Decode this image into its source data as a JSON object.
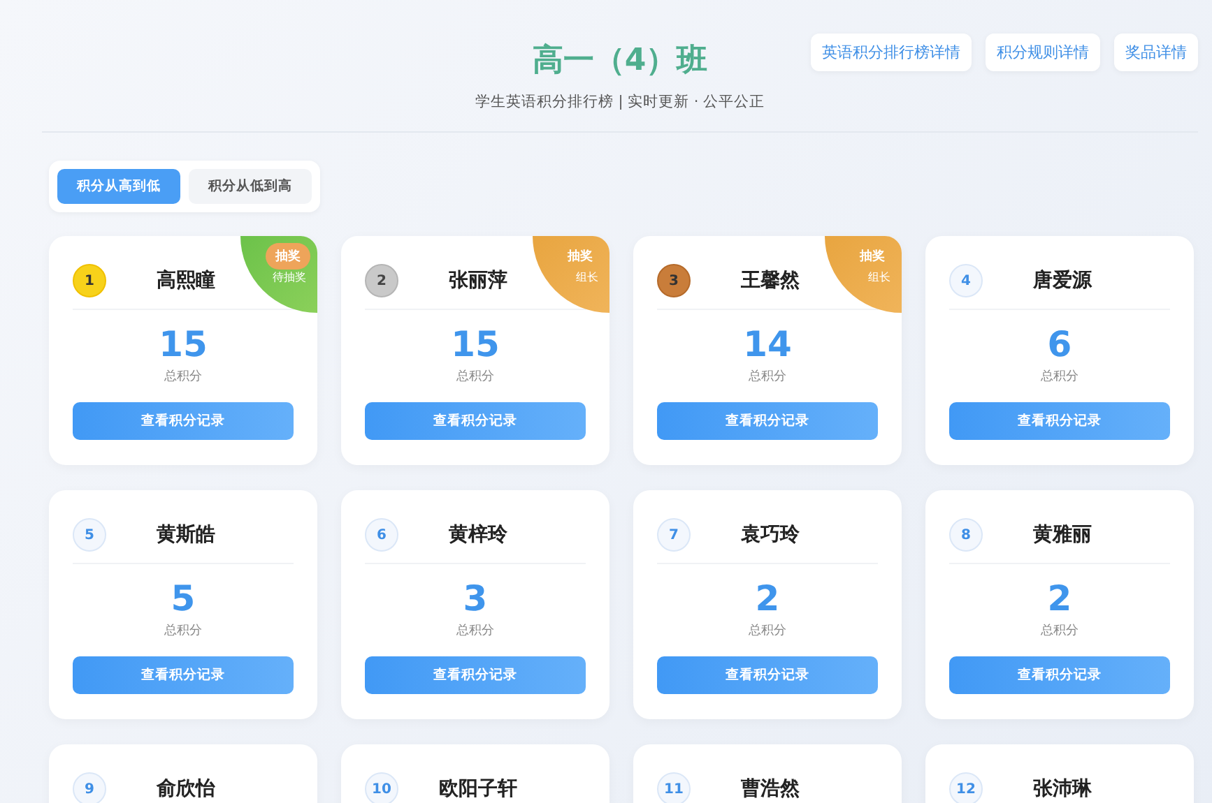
{
  "header": {
    "title": "高一（4）班",
    "subtitle": "学生英语积分排行榜 | 实时更新 · 公平公正",
    "links": [
      "英语积分排行榜详情",
      "积分规则详情",
      "奖品详情"
    ]
  },
  "sort_tabs": [
    {
      "label": "积分从高到低",
      "selected": true
    },
    {
      "label": "积分从低到高",
      "selected": false
    }
  ],
  "students": [
    {
      "rank": "1",
      "kind": "gold",
      "name": "高熙瞳",
      "score": "15",
      "score_label": "总积分",
      "action": "查看积分记录",
      "badge": {
        "kind": "drawn",
        "label": "抽奖",
        "note": "待抽奖"
      }
    },
    {
      "rank": "2",
      "kind": "silver",
      "name": "张丽萍",
      "score": "15",
      "score_label": "总积分",
      "action": "查看积分记录",
      "badge": {
        "kind": "ready",
        "label": "抽奖",
        "note": "组长"
      }
    },
    {
      "rank": "3",
      "kind": "bronze",
      "name": "王馨然",
      "score": "14",
      "score_label": "总积分",
      "action": "查看积分记录",
      "badge": {
        "kind": "ready",
        "label": "抽奖",
        "note": "组长"
      }
    },
    {
      "rank": "4",
      "kind": "plain",
      "name": "唐爱源",
      "score": "6",
      "score_label": "总积分",
      "action": "查看积分记录"
    },
    {
      "rank": "5",
      "kind": "plain",
      "name": "黄斯皓",
      "score": "5",
      "score_label": "总积分",
      "action": "查看积分记录"
    },
    {
      "rank": "6",
      "kind": "plain",
      "name": "黄梓玲",
      "score": "3",
      "score_label": "总积分",
      "action": "查看积分记录"
    },
    {
      "rank": "7",
      "kind": "plain",
      "name": "袁巧玲",
      "score": "2",
      "score_label": "总积分",
      "action": "查看积分记录"
    },
    {
      "rank": "8",
      "kind": "plain",
      "name": "黄雅丽",
      "score": "2",
      "score_label": "总积分",
      "action": "查看积分记录"
    },
    {
      "rank": "9",
      "kind": "plain",
      "name": "俞欣怡"
    },
    {
      "rank": "10",
      "kind": "plain",
      "name": "欧阳子轩"
    },
    {
      "rank": "11",
      "kind": "plain",
      "name": "曹浩然"
    },
    {
      "rank": "12",
      "kind": "plain",
      "name": "张沛琳"
    }
  ]
}
